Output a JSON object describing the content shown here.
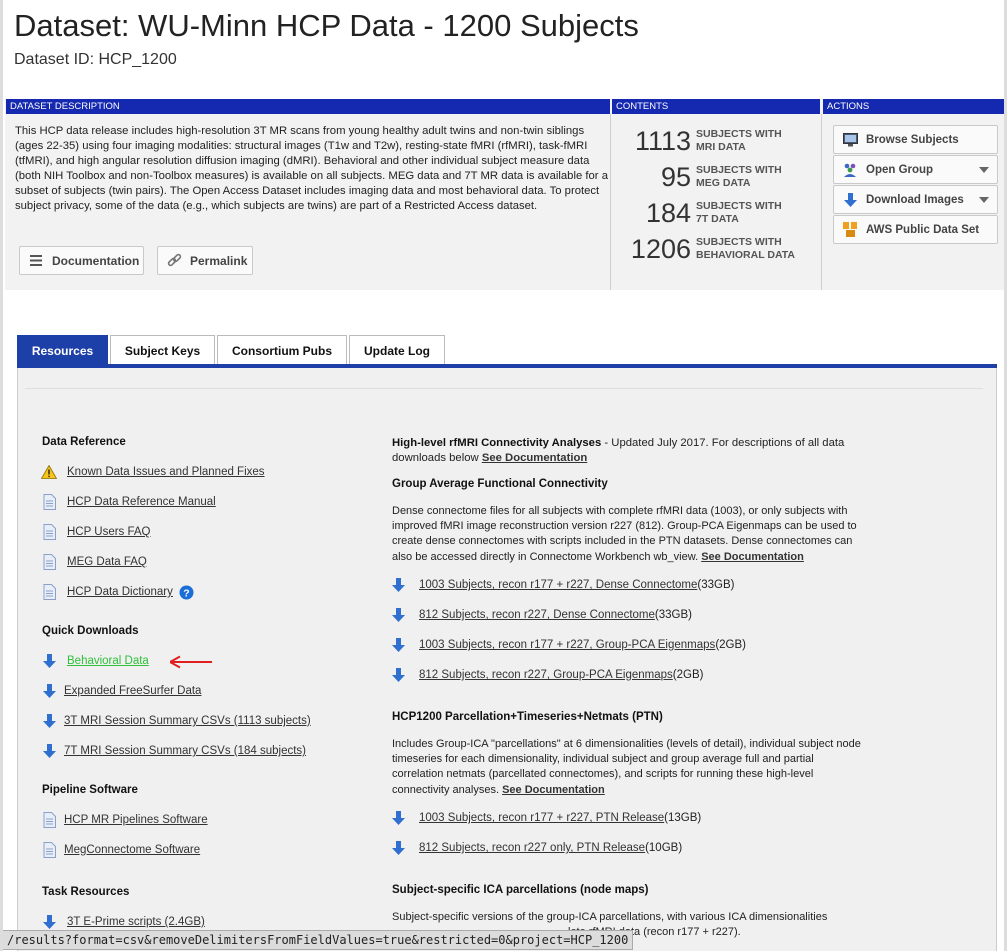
{
  "header": {
    "title": "Dataset: WU-Minn HCP Data - 1200 Subjects",
    "dataset_id": "Dataset ID: HCP_1200"
  },
  "sections": {
    "description_header": "DATASET DESCRIPTION",
    "contents_header": "CONTENTS",
    "actions_header": "ACTIONS"
  },
  "description": {
    "text": "This HCP data release includes high-resolution 3T MR scans from young healthy adult twins and non-twin siblings (ages 22-35) using four imaging modalities: structural images (T1w and T2w), resting-state fMRI (rfMRI), task-fMRI (tfMRI), and high angular resolution diffusion imaging (dMRI). Behavioral and other individual subject measure data (both NIH Toolbox and non-Toolbox measures) is available on all subjects. MEG data and 7T MR data is available for a subset of subjects (twin pairs). The Open Access Dataset includes imaging data and most behavioral data. To protect subject privacy, some of the data (e.g., which subjects are twins) are part of a Restricted Access dataset.",
    "documentation_label": "Documentation",
    "permalink_label": "Permalink"
  },
  "contents": [
    {
      "count": "1113",
      "line1": "SUBJECTS WITH",
      "line2": "MRI DATA"
    },
    {
      "count": "95",
      "line1": "SUBJECTS WITH",
      "line2": "MEG DATA"
    },
    {
      "count": "184",
      "line1": "SUBJECTS WITH",
      "line2": "7T DATA"
    },
    {
      "count": "1206",
      "line1": "SUBJECTS WITH",
      "line2": "BEHAVIORAL DATA"
    }
  ],
  "actions": [
    {
      "label": "Browse Subjects",
      "icon": "monitor-icon"
    },
    {
      "label": "Open Group",
      "icon": "group-icon"
    },
    {
      "label": "Download Images",
      "icon": "download-arrow-icon"
    },
    {
      "label": "AWS Public Data Set",
      "icon": "aws-icon"
    }
  ],
  "tabs": [
    "Resources",
    "Subject Keys",
    "Consortium Pubs",
    "Update Log"
  ],
  "left": {
    "data_reference_title": "Data Reference",
    "data_reference": [
      "Known Data Issues and Planned Fixes",
      "HCP Data Reference Manual",
      "HCP Users FAQ",
      "MEG Data FAQ",
      "HCP Data Dictionary"
    ],
    "quick_downloads_title": "Quick Downloads",
    "quick_downloads": [
      "Behavioral Data",
      "Expanded FreeSurfer Data",
      "3T MRI Session Summary CSVs (1113 subjects)",
      "7T MRI Session Summary CSVs (184 subjects)"
    ],
    "pipeline_title": "Pipeline Software",
    "pipeline": [
      "HCP MR Pipelines Software",
      "MegConnectome Software"
    ],
    "task_title": "Task Resources",
    "task": [
      "3T E-Prime scripts (2.4GB)"
    ]
  },
  "right": {
    "rfmri_title": "High-level rfMRI Connectivity Analyses",
    "rfmri_updated": " - Updated July 2017. For descriptions of all data downloads below ",
    "see_documentation": "See Documentation",
    "gafc_title": "Group Average Functional Connectivity",
    "gafc_text": "Dense connectome files for all subjects with complete rfMRI data (1003), or only subjects with improved fMRI image reconstruction version r227 (812). Group-PCA Eigenmaps can be used to create dense connectomes with scripts included in the PTN datasets. Dense connectomes can also be accessed directly in Connectome Workbench wb_view. ",
    "gafc_links": [
      {
        "label": "1003 Subjects, recon r177 + r227, Dense Connectome",
        "size": " (33GB)"
      },
      {
        "label": "812 Subjects, recon r227, Dense Connectome",
        "size": " (33GB)"
      },
      {
        "label": "1003 Subjects, recon r177 + r227, Group-PCA Eigenmaps",
        "size": " (2GB)"
      },
      {
        "label": "812 Subjects, recon r227, Group-PCA Eigenmaps",
        "size": " (2GB)"
      }
    ],
    "ptn_title": "HCP1200 Parcellation+Timeseries+Netmats (PTN)",
    "ptn_text": "Includes Group-ICA \"parcellations\" at 6 dimensionalities (levels of detail), individual subject node timeseries for each dimensionality, individual subject and group average full and partial correlation netmats (parcellated connectomes), and scripts for running these high-level connectivity analyses. ",
    "ptn_links": [
      {
        "label": "1003 Subjects, recon r177 + r227, PTN Release",
        "size": " (13GB)"
      },
      {
        "label": "812 Subjects, recon r227 only, PTN Release",
        "size": " (10GB)"
      }
    ],
    "ica_title": "Subject-specific ICA parcellations (node maps)",
    "ica_text_line1": "Subject-specific versions of the group-ICA parcellations, with various ICA dimensionalities",
    "ica_text_line2": "lete rfMRI data (recon r177 + r227)."
  },
  "status_bar": "/results?format=csv&removeDelimitersFromFieldValues=true&restricted=0&project=HCP_1200",
  "colors": {
    "accent": "#1529b0",
    "tab_active": "#1d3fa8",
    "link_highlight": "#2fbf3a",
    "annotation": "#e02020"
  }
}
